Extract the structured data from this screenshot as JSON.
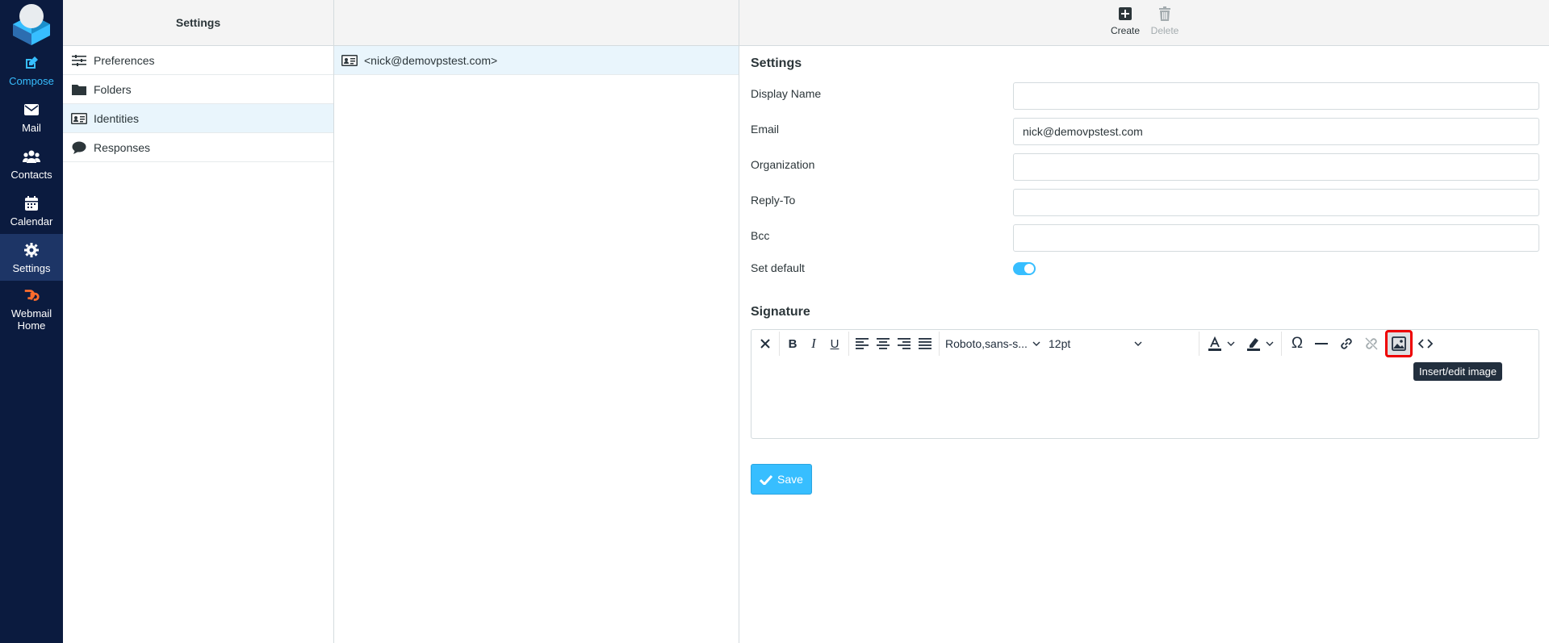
{
  "nav": {
    "items": [
      {
        "label": "Compose",
        "icon": "compose-icon"
      },
      {
        "label": "Mail",
        "icon": "mail-icon"
      },
      {
        "label": "Contacts",
        "icon": "contacts-icon"
      },
      {
        "label": "Calendar",
        "icon": "calendar-icon"
      },
      {
        "label": "Settings",
        "icon": "gear-icon"
      },
      {
        "label": "Webmail Home",
        "icon": "cpanel-icon"
      }
    ],
    "active": "Settings",
    "accent_color": "#37beff",
    "background_color": "#0b1b3f"
  },
  "settings_menu": {
    "title": "Settings",
    "items": [
      {
        "label": "Preferences",
        "icon": "sliders-icon"
      },
      {
        "label": "Folders",
        "icon": "folder-icon"
      },
      {
        "label": "Identities",
        "icon": "id-card-icon"
      },
      {
        "label": "Responses",
        "icon": "comment-icon"
      }
    ],
    "selected": "Identities"
  },
  "identities": {
    "items": [
      {
        "label": "<nick@demovpstest.com>",
        "icon": "id-card-icon"
      }
    ]
  },
  "toolbar": {
    "create_label": "Create",
    "delete_label": "Delete"
  },
  "form": {
    "settings_title": "Settings",
    "display_name_label": "Display Name",
    "display_name_value": "",
    "email_label": "Email",
    "email_value": "nick@demovpstest.com",
    "organization_label": "Organization",
    "organization_value": "",
    "reply_to_label": "Reply-To",
    "reply_to_value": "",
    "bcc_label": "Bcc",
    "bcc_value": "",
    "set_default_label": "Set default",
    "set_default_on": true,
    "signature_title": "Signature",
    "save_label": "Save"
  },
  "editor": {
    "font_family": "Roboto,sans-s...",
    "font_size": "12pt",
    "tooltip": "Insert/edit image"
  }
}
